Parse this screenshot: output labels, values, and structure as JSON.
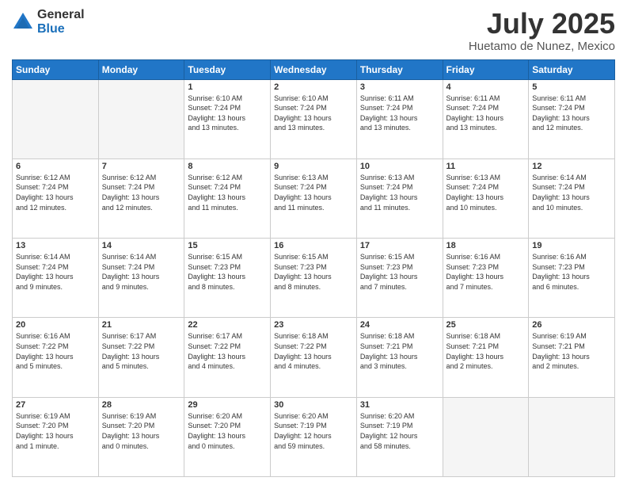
{
  "logo": {
    "general": "General",
    "blue": "Blue"
  },
  "title": "July 2025",
  "location": "Huetamo de Nunez, Mexico",
  "days": [
    "Sunday",
    "Monday",
    "Tuesday",
    "Wednesday",
    "Thursday",
    "Friday",
    "Saturday"
  ],
  "weeks": [
    [
      {
        "day": "",
        "content": ""
      },
      {
        "day": "",
        "content": ""
      },
      {
        "day": "1",
        "content": "Sunrise: 6:10 AM\nSunset: 7:24 PM\nDaylight: 13 hours\nand 13 minutes."
      },
      {
        "day": "2",
        "content": "Sunrise: 6:10 AM\nSunset: 7:24 PM\nDaylight: 13 hours\nand 13 minutes."
      },
      {
        "day": "3",
        "content": "Sunrise: 6:11 AM\nSunset: 7:24 PM\nDaylight: 13 hours\nand 13 minutes."
      },
      {
        "day": "4",
        "content": "Sunrise: 6:11 AM\nSunset: 7:24 PM\nDaylight: 13 hours\nand 13 minutes."
      },
      {
        "day": "5",
        "content": "Sunrise: 6:11 AM\nSunset: 7:24 PM\nDaylight: 13 hours\nand 12 minutes."
      }
    ],
    [
      {
        "day": "6",
        "content": "Sunrise: 6:12 AM\nSunset: 7:24 PM\nDaylight: 13 hours\nand 12 minutes."
      },
      {
        "day": "7",
        "content": "Sunrise: 6:12 AM\nSunset: 7:24 PM\nDaylight: 13 hours\nand 12 minutes."
      },
      {
        "day": "8",
        "content": "Sunrise: 6:12 AM\nSunset: 7:24 PM\nDaylight: 13 hours\nand 11 minutes."
      },
      {
        "day": "9",
        "content": "Sunrise: 6:13 AM\nSunset: 7:24 PM\nDaylight: 13 hours\nand 11 minutes."
      },
      {
        "day": "10",
        "content": "Sunrise: 6:13 AM\nSunset: 7:24 PM\nDaylight: 13 hours\nand 11 minutes."
      },
      {
        "day": "11",
        "content": "Sunrise: 6:13 AM\nSunset: 7:24 PM\nDaylight: 13 hours\nand 10 minutes."
      },
      {
        "day": "12",
        "content": "Sunrise: 6:14 AM\nSunset: 7:24 PM\nDaylight: 13 hours\nand 10 minutes."
      }
    ],
    [
      {
        "day": "13",
        "content": "Sunrise: 6:14 AM\nSunset: 7:24 PM\nDaylight: 13 hours\nand 9 minutes."
      },
      {
        "day": "14",
        "content": "Sunrise: 6:14 AM\nSunset: 7:24 PM\nDaylight: 13 hours\nand 9 minutes."
      },
      {
        "day": "15",
        "content": "Sunrise: 6:15 AM\nSunset: 7:23 PM\nDaylight: 13 hours\nand 8 minutes."
      },
      {
        "day": "16",
        "content": "Sunrise: 6:15 AM\nSunset: 7:23 PM\nDaylight: 13 hours\nand 8 minutes."
      },
      {
        "day": "17",
        "content": "Sunrise: 6:15 AM\nSunset: 7:23 PM\nDaylight: 13 hours\nand 7 minutes."
      },
      {
        "day": "18",
        "content": "Sunrise: 6:16 AM\nSunset: 7:23 PM\nDaylight: 13 hours\nand 7 minutes."
      },
      {
        "day": "19",
        "content": "Sunrise: 6:16 AM\nSunset: 7:23 PM\nDaylight: 13 hours\nand 6 minutes."
      }
    ],
    [
      {
        "day": "20",
        "content": "Sunrise: 6:16 AM\nSunset: 7:22 PM\nDaylight: 13 hours\nand 5 minutes."
      },
      {
        "day": "21",
        "content": "Sunrise: 6:17 AM\nSunset: 7:22 PM\nDaylight: 13 hours\nand 5 minutes."
      },
      {
        "day": "22",
        "content": "Sunrise: 6:17 AM\nSunset: 7:22 PM\nDaylight: 13 hours\nand 4 minutes."
      },
      {
        "day": "23",
        "content": "Sunrise: 6:18 AM\nSunset: 7:22 PM\nDaylight: 13 hours\nand 4 minutes."
      },
      {
        "day": "24",
        "content": "Sunrise: 6:18 AM\nSunset: 7:21 PM\nDaylight: 13 hours\nand 3 minutes."
      },
      {
        "day": "25",
        "content": "Sunrise: 6:18 AM\nSunset: 7:21 PM\nDaylight: 13 hours\nand 2 minutes."
      },
      {
        "day": "26",
        "content": "Sunrise: 6:19 AM\nSunset: 7:21 PM\nDaylight: 13 hours\nand 2 minutes."
      }
    ],
    [
      {
        "day": "27",
        "content": "Sunrise: 6:19 AM\nSunset: 7:20 PM\nDaylight: 13 hours\nand 1 minute."
      },
      {
        "day": "28",
        "content": "Sunrise: 6:19 AM\nSunset: 7:20 PM\nDaylight: 13 hours\nand 0 minutes."
      },
      {
        "day": "29",
        "content": "Sunrise: 6:20 AM\nSunset: 7:20 PM\nDaylight: 13 hours\nand 0 minutes."
      },
      {
        "day": "30",
        "content": "Sunrise: 6:20 AM\nSunset: 7:19 PM\nDaylight: 12 hours\nand 59 minutes."
      },
      {
        "day": "31",
        "content": "Sunrise: 6:20 AM\nSunset: 7:19 PM\nDaylight: 12 hours\nand 58 minutes."
      },
      {
        "day": "",
        "content": ""
      },
      {
        "day": "",
        "content": ""
      }
    ]
  ]
}
